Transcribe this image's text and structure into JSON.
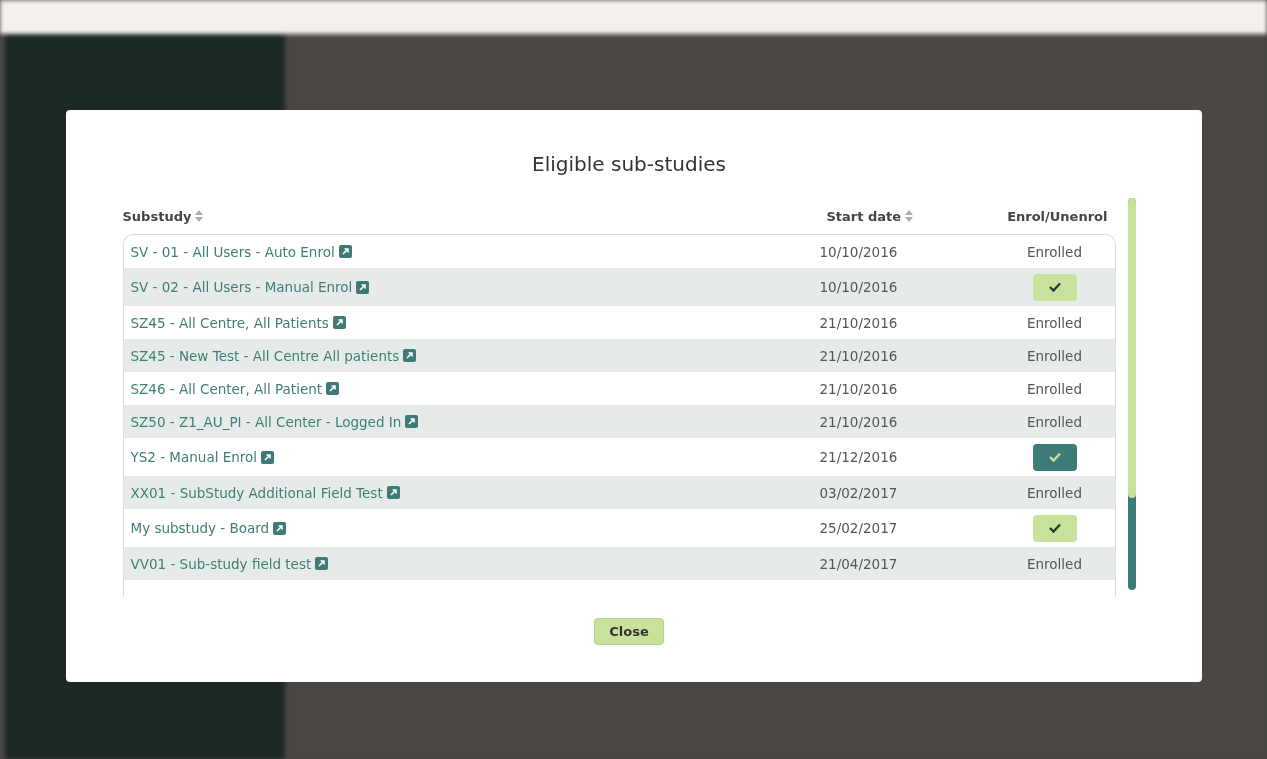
{
  "dialog": {
    "title": "Eligible sub-studies",
    "columns": [
      {
        "label": "Substudy",
        "sortable": true
      },
      {
        "label": "Start date",
        "sortable": true
      },
      {
        "label": "Enrol/Unenrol",
        "sortable": false
      }
    ],
    "rows": [
      {
        "substudy": "SV - 01 - All Users - Auto Enrol",
        "start_date": "10/10/2016",
        "kind": "enrolled",
        "status": "Enrolled"
      },
      {
        "substudy": "SV - 02 - All Users - Manual Enrol",
        "start_date": "10/10/2016",
        "kind": "button",
        "hovered": false
      },
      {
        "substudy": "SZ45 - All Centre, All Patients",
        "start_date": "21/10/2016",
        "kind": "enrolled",
        "status": "Enrolled"
      },
      {
        "substudy": "SZ45 - New Test - All Centre All patients",
        "start_date": "21/10/2016",
        "kind": "enrolled",
        "status": "Enrolled"
      },
      {
        "substudy": "SZ46 - All Center, All Patient",
        "start_date": "21/10/2016",
        "kind": "enrolled",
        "status": "Enrolled"
      },
      {
        "substudy": "SZ50 - Z1_AU_PI - All Center - Logged In",
        "start_date": "21/10/2016",
        "kind": "enrolled",
        "status": "Enrolled"
      },
      {
        "substudy": "YS2 - Manual Enrol",
        "start_date": "21/12/2016",
        "kind": "button",
        "hovered": true
      },
      {
        "substudy": "XX01 - SubStudy Additional Field Test",
        "start_date": "03/02/2017",
        "kind": "enrolled",
        "status": "Enrolled"
      },
      {
        "substudy": "My substudy - Board",
        "start_date": "25/02/2017",
        "kind": "button",
        "hovered": false
      },
      {
        "substudy": "VV01 - Sub-study field test",
        "start_date": "21/04/2017",
        "kind": "enrolled",
        "status": "Enrolled"
      }
    ],
    "close_button": "Close"
  }
}
